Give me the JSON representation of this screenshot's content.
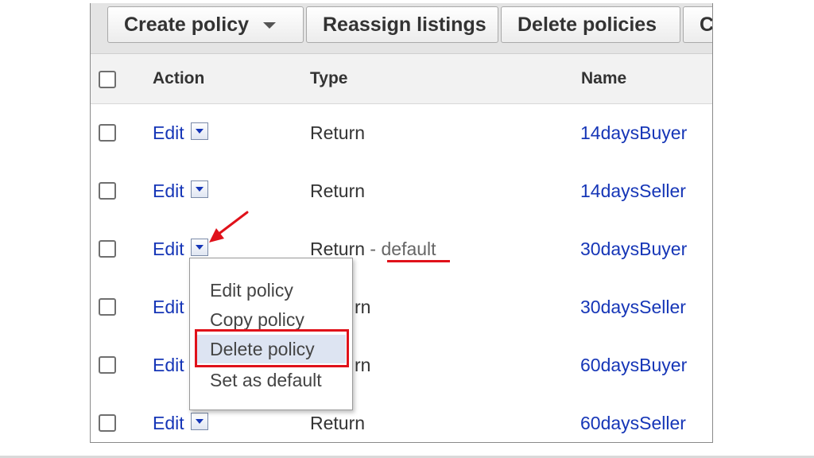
{
  "toolbar": {
    "create_policy": "Create policy",
    "reassign_listings": "Reassign listings",
    "delete_policies": "Delete policies",
    "cut_button": "C"
  },
  "table": {
    "headers": {
      "action": "Action",
      "type": "Type",
      "name": "Name"
    },
    "rows": [
      {
        "action": "Edit",
        "type": "Return",
        "name": "14daysBuyer"
      },
      {
        "action": "Edit",
        "type": "Return",
        "name": "14daysSeller"
      },
      {
        "action": "Edit",
        "type": "Return",
        "type_separator": " - ",
        "type_default": "default",
        "name": "30daysBuyer"
      },
      {
        "action": "Edit",
        "type": "rn",
        "name": "30daysSeller"
      },
      {
        "action": "Edit",
        "type": "rn",
        "name": "60daysBuyer"
      },
      {
        "action": "Edit",
        "type": "Return",
        "name": "60daysSeller"
      }
    ]
  },
  "dropdown_menu": {
    "items": [
      "Edit policy",
      "Copy policy",
      "Delete policy",
      "Set as default"
    ],
    "highlighted": "Delete policy"
  },
  "annotations": {
    "color": "#e0111a"
  },
  "colors": {
    "link": "#1636b7",
    "text": "#333333"
  }
}
